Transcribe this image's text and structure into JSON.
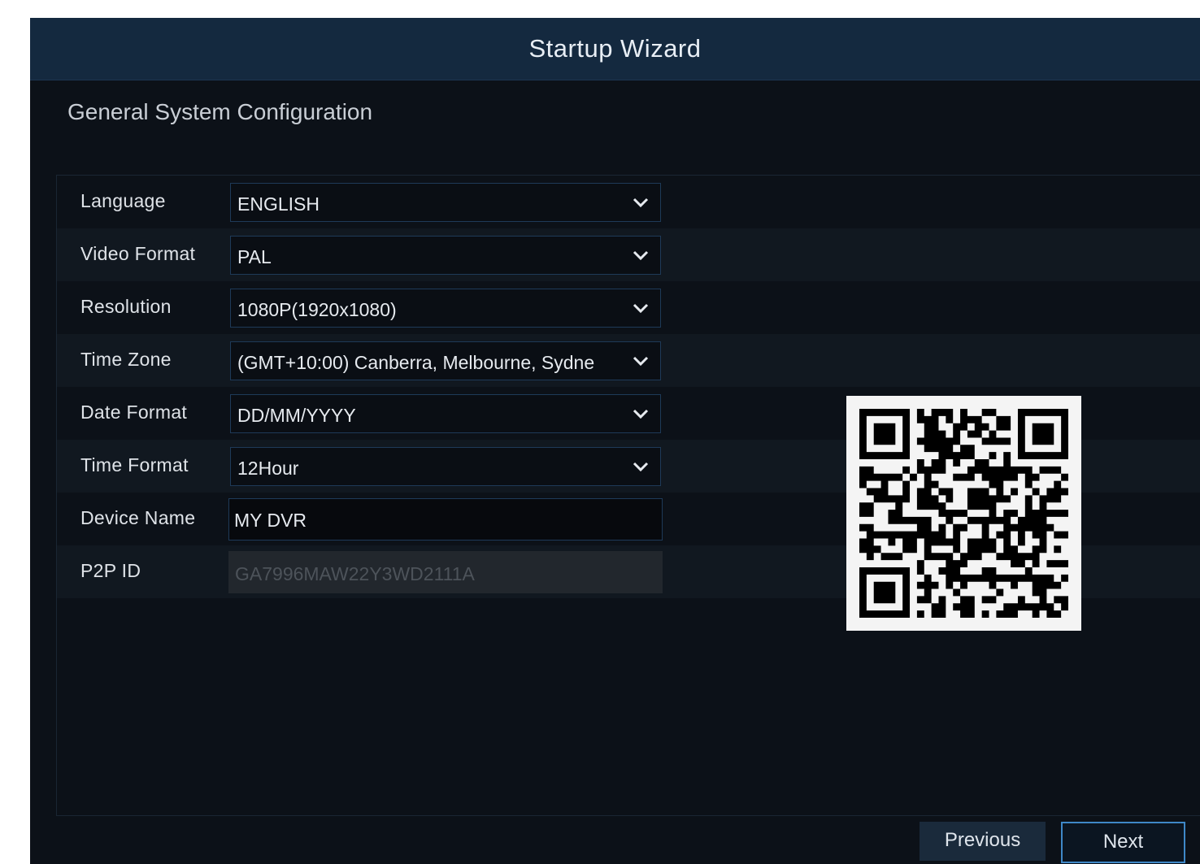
{
  "window": {
    "title": "Startup Wizard"
  },
  "section": {
    "title": "General System Configuration"
  },
  "fields": {
    "language": {
      "label": "Language",
      "value": "ENGLISH"
    },
    "video_format": {
      "label": "Video Format",
      "value": "PAL"
    },
    "resolution": {
      "label": "Resolution",
      "value": "1080P(1920x1080)"
    },
    "time_zone": {
      "label": "Time Zone",
      "value": "(GMT+10:00) Canberra, Melbourne, Sydne"
    },
    "date_format": {
      "label": "Date Format",
      "value": "DD/MM/YYYY"
    },
    "time_format": {
      "label": "Time Format",
      "value": "12Hour"
    },
    "device_name": {
      "label": "Device Name",
      "value": "MY DVR"
    },
    "p2p_id": {
      "label": "P2P ID",
      "value": "GA7996MAW22Y3WD2111A"
    }
  },
  "qr": {
    "icon": "qr-code"
  },
  "buttons": {
    "previous": "Previous",
    "next": "Next"
  },
  "colors": {
    "titlebar": "#14293f",
    "background": "#0c1118",
    "accent_border": "#3f88c8"
  }
}
